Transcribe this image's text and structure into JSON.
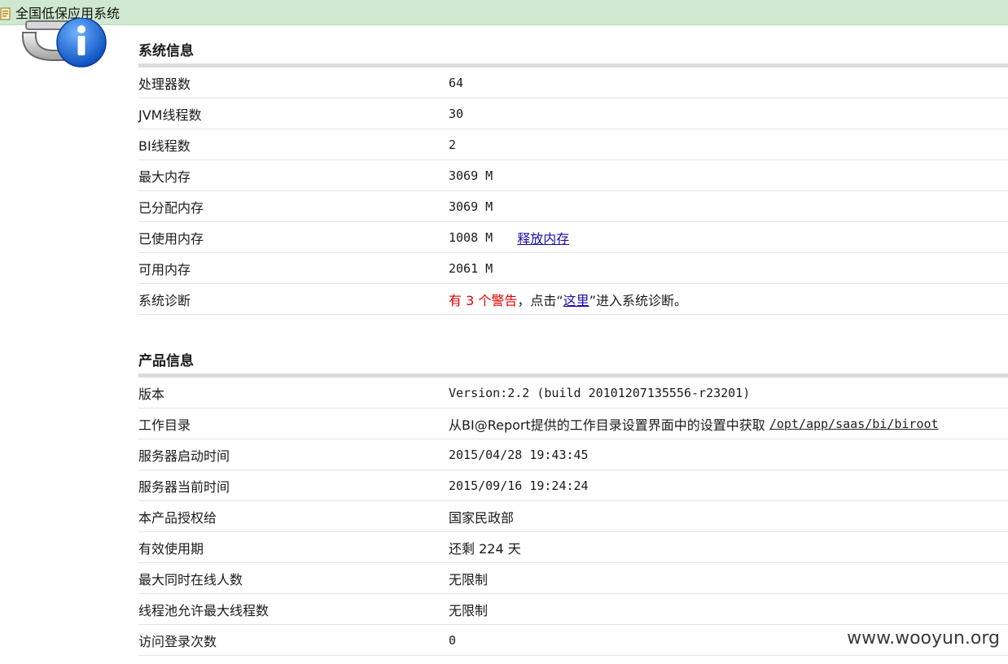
{
  "window": {
    "title": "全国低保应用系统"
  },
  "system_info": {
    "heading": "系统信息",
    "rows": [
      {
        "label": "处理器数",
        "value": "64"
      },
      {
        "label": "JVM线程数",
        "value": "30"
      },
      {
        "label": "BI线程数",
        "value": "2"
      },
      {
        "label": "最大内存",
        "value": "3069 M"
      },
      {
        "label": "已分配内存",
        "value": "3069 M"
      },
      {
        "label": "已使用内存",
        "value": "1008 M",
        "link": "释放内存"
      },
      {
        "label": "可用内存",
        "value": "2061 M"
      }
    ],
    "diagnosis": {
      "label": "系统诊断",
      "warn_prefix": "有 ",
      "warn_count": "3",
      "warn_suffix": " 个警告",
      "text_before_link": "，点击“",
      "link": "这里",
      "text_after_link": "”进入系统诊断。"
    }
  },
  "product_info": {
    "heading": "产品信息",
    "version": {
      "label": "版本",
      "value": "Version:2.2 (build 20101207135556-r23201)"
    },
    "workdir": {
      "label": "工作目录",
      "text": "从BI@Report提供的工作目录设置界面中的设置中获取 ",
      "path": "/opt/app/saas/bi/biroot"
    },
    "start_time": {
      "label": "服务器启动时间",
      "value": "2015/04/28 19:43:45"
    },
    "current_time": {
      "label": "服务器当前时间",
      "value": "2015/09/16 19:24:24"
    },
    "licensee": {
      "label": "本产品授权给",
      "value": "国家民政部"
    },
    "validity": {
      "label": "有效使用期",
      "value": "还剩 224 天"
    },
    "max_online": {
      "label": "最大同时在线人数",
      "value": "无限制"
    },
    "max_threads": {
      "label": "线程池允许最大线程数",
      "value": "无限制"
    },
    "login_count": {
      "label": "访问登录次数",
      "value": "0"
    }
  },
  "watermark": "www.wooyun.org",
  "colors": {
    "titlebar": "#cfe8cf",
    "warning": "#e00000",
    "link": "#1a0dab"
  }
}
